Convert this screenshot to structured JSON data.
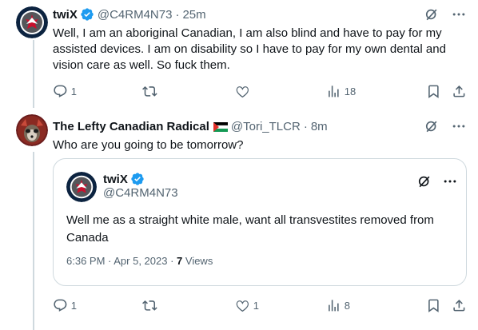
{
  "post1": {
    "name": "twiX",
    "handle": "@C4RM4N73",
    "time": "25m",
    "text": "Well, I am an aboriginal Canadian, I am also blind and have to pay for my assisted devices. I am on disability so I have to pay for my own dental and vision care as well. So fuck them.",
    "replies": "1",
    "reposts": "",
    "likes": "",
    "views": "18"
  },
  "post2": {
    "name": "The Lefty Canadian Radical",
    "handle": "@Tori_TLCR",
    "time": "8m",
    "text": "Who are you going to be tomorrow?",
    "replies": "1",
    "reposts": "",
    "likes": "1",
    "views": "8"
  },
  "quote": {
    "name": "twiX",
    "handle": "@C4RM4N73",
    "text": "Well me as a straight white male, want all transvestites removed from Canada",
    "date": "6:36 PM · Apr 5, 2023 · ",
    "views_count": "7",
    "views_label": " Views"
  },
  "colors": {
    "verified": "#1d9bf0",
    "secondary_text": "#536471",
    "border": "#cfd9de"
  },
  "icons": [
    "grok-icon",
    "more-icon",
    "reply-icon",
    "repost-icon",
    "like-icon",
    "views-icon",
    "bookmark-icon",
    "share-icon",
    "verified-icon",
    "palestine-flag-icon"
  ]
}
